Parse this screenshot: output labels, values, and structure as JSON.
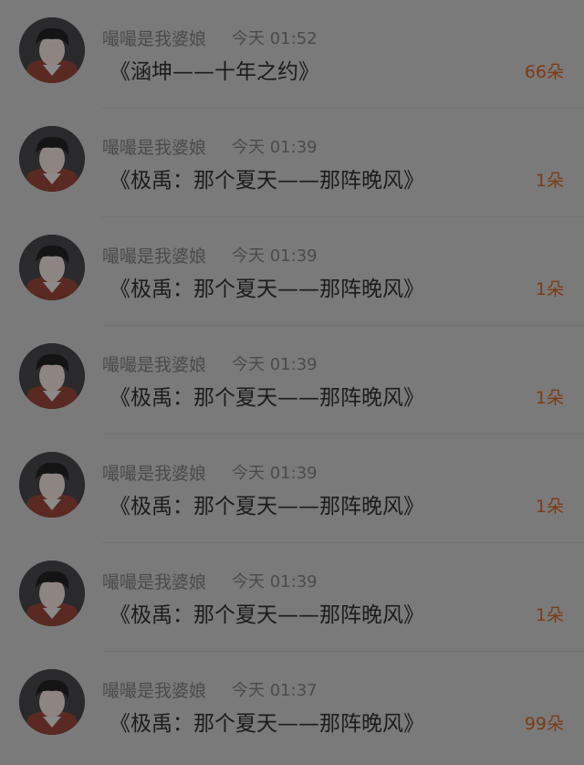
{
  "accent_color": "#7c3b16",
  "items": [
    {
      "user": "嘬嘬是我婆娘",
      "time": "今天 01:52",
      "title": "《涵坤——十年之约》",
      "count": "66朵"
    },
    {
      "user": "嘬嘬是我婆娘",
      "time": "今天 01:39",
      "title": "《极禹：那个夏天——那阵晚风》",
      "count": "1朵"
    },
    {
      "user": "嘬嘬是我婆娘",
      "time": "今天 01:39",
      "title": "《极禹：那个夏天——那阵晚风》",
      "count": "1朵"
    },
    {
      "user": "嘬嘬是我婆娘",
      "time": "今天 01:39",
      "title": "《极禹：那个夏天——那阵晚风》",
      "count": "1朵"
    },
    {
      "user": "嘬嘬是我婆娘",
      "time": "今天 01:39",
      "title": "《极禹：那个夏天——那阵晚风》",
      "count": "1朵"
    },
    {
      "user": "嘬嘬是我婆娘",
      "time": "今天 01:39",
      "title": "《极禹：那个夏天——那阵晚风》",
      "count": "1朵"
    },
    {
      "user": "嘬嘬是我婆娘",
      "time": "今天 01:37",
      "title": "《极禹：那个夏天——那阵晚风》",
      "count": "99朵"
    }
  ]
}
